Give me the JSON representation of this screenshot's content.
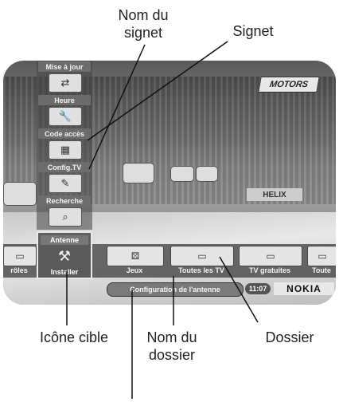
{
  "callouts": {
    "bookmark_name": [
      "Nom du",
      "signet"
    ],
    "bookmark": "Signet",
    "target_icon": "Icône cible",
    "folder_name": [
      "Nom du",
      "dossier"
    ],
    "folder": "Dossier"
  },
  "scene": {
    "sponsor": "MOTORS",
    "banner": "HELIX"
  },
  "bookmarks": [
    {
      "label": "Mise à jour",
      "icon": "satellite-update-icon",
      "glyph": "⇄"
    },
    {
      "label": "Heure",
      "icon": "clock-wrench-icon",
      "glyph": "🔧"
    },
    {
      "label": "Code accès",
      "icon": "keypad-icon",
      "glyph": "▦"
    },
    {
      "label": "Config.TV",
      "icon": "tv-config-icon",
      "glyph": "✎"
    },
    {
      "label": "Recherche",
      "icon": "search-icon",
      "glyph": "⌕"
    }
  ],
  "target": {
    "label": "Antenne",
    "name": "Installer",
    "icon": "antenna-tools-icon",
    "glyph": "⚒"
  },
  "folders": [
    {
      "label": "rôles",
      "icon": "controls-icon",
      "glyph": "▭"
    },
    {
      "label": "Jeux",
      "icon": "dice-icon",
      "glyph": "⚄"
    },
    {
      "label": "Toutes les TV",
      "icon": "tv-folder-icon",
      "glyph": "▭"
    },
    {
      "label": "TV gratuites",
      "icon": "tv-free-icon",
      "glyph": "▭"
    },
    {
      "label": "Toute",
      "icon": "folder-icon",
      "glyph": "▭"
    }
  ],
  "status": {
    "title": "Configuration de l'antenne",
    "time": "11:07",
    "brand": "NOKIA"
  },
  "colors": {
    "leader": "#111111",
    "focus_border": "#e8e8e8"
  }
}
